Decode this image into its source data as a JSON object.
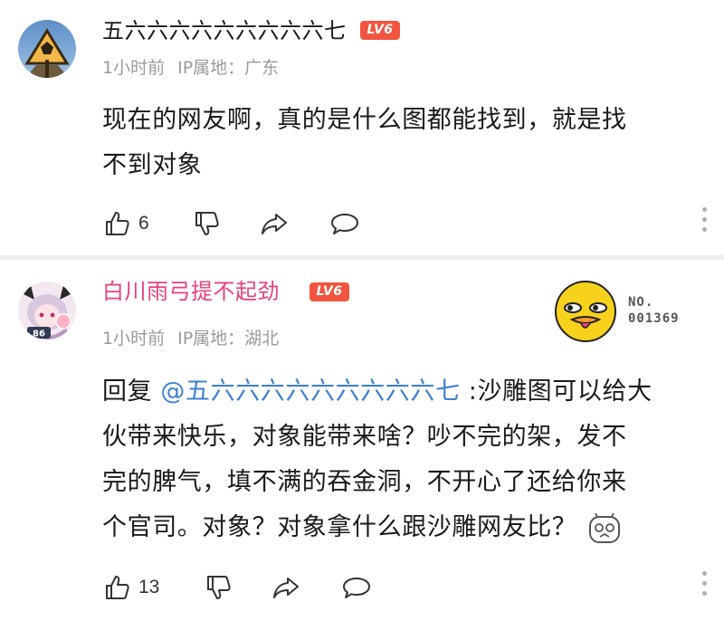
{
  "comments": [
    {
      "username": "五六六六六六六六六六七",
      "level": "LV6",
      "time": "1小时前",
      "ip_label": "IP属地：广东",
      "text_lines": [
        "现在的网友啊，真的是什么图都能找到，就是找",
        "不到对象"
      ],
      "likes": "6",
      "avatar_icon": "triangle-warning-avatar"
    },
    {
      "username": "白川雨弓提不起劲",
      "username_color": "#e8417f",
      "level": "LV6",
      "time": "1小时前",
      "ip_label": "IP属地：湖北",
      "reply_prefix": "回复 ",
      "mention": "@五六六六六六六六六六七",
      "line1_rest": " :沙雕图可以给大",
      "text_lines": [
        "伙带来快乐，对象能带来啥？吵不完的架，发不",
        "完的脾气，填不满的吞金洞，不开心了还给你来",
        "个官司。对象？对象拿什么跟沙雕网友比？"
      ],
      "likes": "13",
      "avatar_badge": "86",
      "sticker": {
        "no_label": "NO.",
        "no_number": "001369"
      }
    }
  ]
}
